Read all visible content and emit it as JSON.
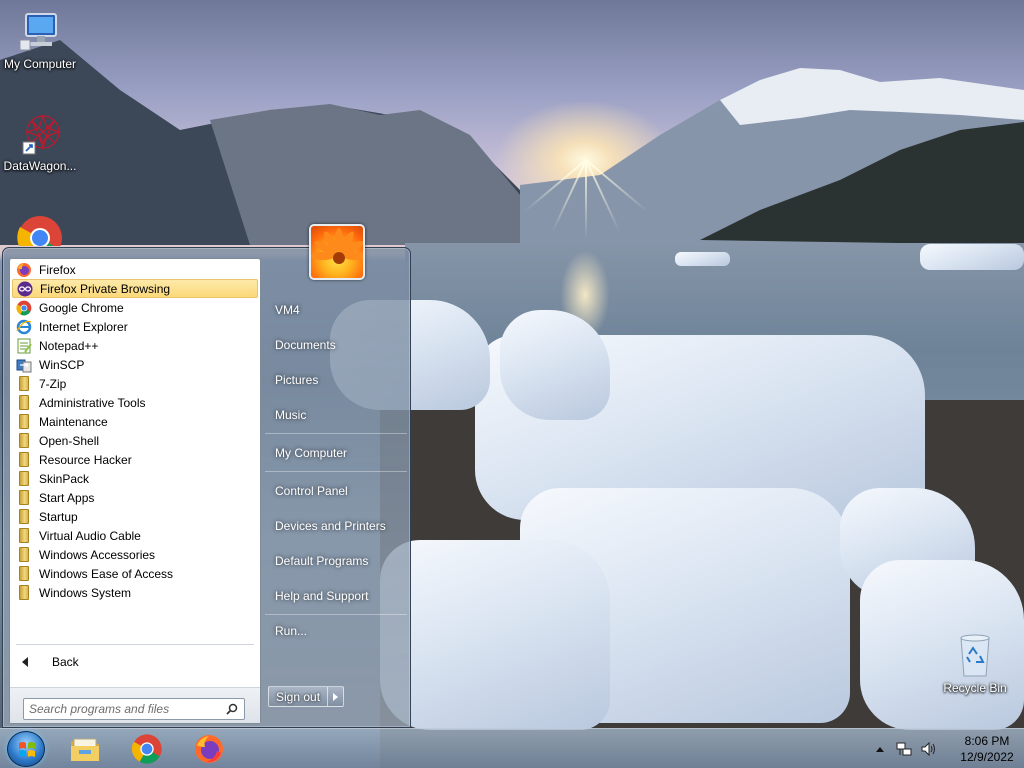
{
  "desktop": {
    "icons": [
      {
        "label": "My Computer",
        "icon": "computer-icon"
      },
      {
        "label": "DataWagon...",
        "icon": "datawagon-icon"
      },
      {
        "label": "",
        "icon": "chrome-icon"
      },
      {
        "label": "Recycle Bin",
        "icon": "recycle-bin-icon"
      }
    ]
  },
  "start_menu": {
    "programs": [
      {
        "label": "Firefox",
        "icon": "firefox-icon"
      },
      {
        "label": "Firefox Private Browsing",
        "icon": "firefox-private-icon",
        "highlighted": true
      },
      {
        "label": "Google Chrome",
        "icon": "chrome-icon"
      },
      {
        "label": "Internet Explorer",
        "icon": "ie-icon"
      },
      {
        "label": "Notepad++",
        "icon": "notepad-icon"
      },
      {
        "label": "WinSCP",
        "icon": "winscp-icon"
      },
      {
        "label": "7-Zip",
        "icon": "folder-icon"
      },
      {
        "label": "Administrative Tools",
        "icon": "folder-icon"
      },
      {
        "label": "Maintenance",
        "icon": "folder-icon"
      },
      {
        "label": "Open-Shell",
        "icon": "folder-icon"
      },
      {
        "label": "Resource Hacker",
        "icon": "folder-icon"
      },
      {
        "label": "SkinPack",
        "icon": "folder-icon"
      },
      {
        "label": "Start Apps",
        "icon": "folder-icon"
      },
      {
        "label": "Startup",
        "icon": "folder-icon"
      },
      {
        "label": "Virtual Audio Cable",
        "icon": "folder-icon"
      },
      {
        "label": "Windows Accessories",
        "icon": "folder-icon"
      },
      {
        "label": "Windows Ease of Access",
        "icon": "folder-icon"
      },
      {
        "label": "Windows System",
        "icon": "folder-icon"
      }
    ],
    "back_label": "Back",
    "search_placeholder": "Search programs and files",
    "right_items": [
      "VM4",
      "Documents",
      "Pictures",
      "Music",
      "My Computer",
      "Control Panel",
      "Devices and Printers",
      "Default Programs",
      "Help and Support",
      "Run..."
    ],
    "sign_out_label": "Sign out"
  },
  "taskbar": {
    "pinned": [
      "file-explorer-icon",
      "chrome-icon",
      "firefox-icon"
    ],
    "tray_icons": [
      "show-hidden-icons-icon",
      "network-icon",
      "volume-icon"
    ],
    "clock_time": "8:06 PM",
    "clock_date": "12/9/2022"
  }
}
